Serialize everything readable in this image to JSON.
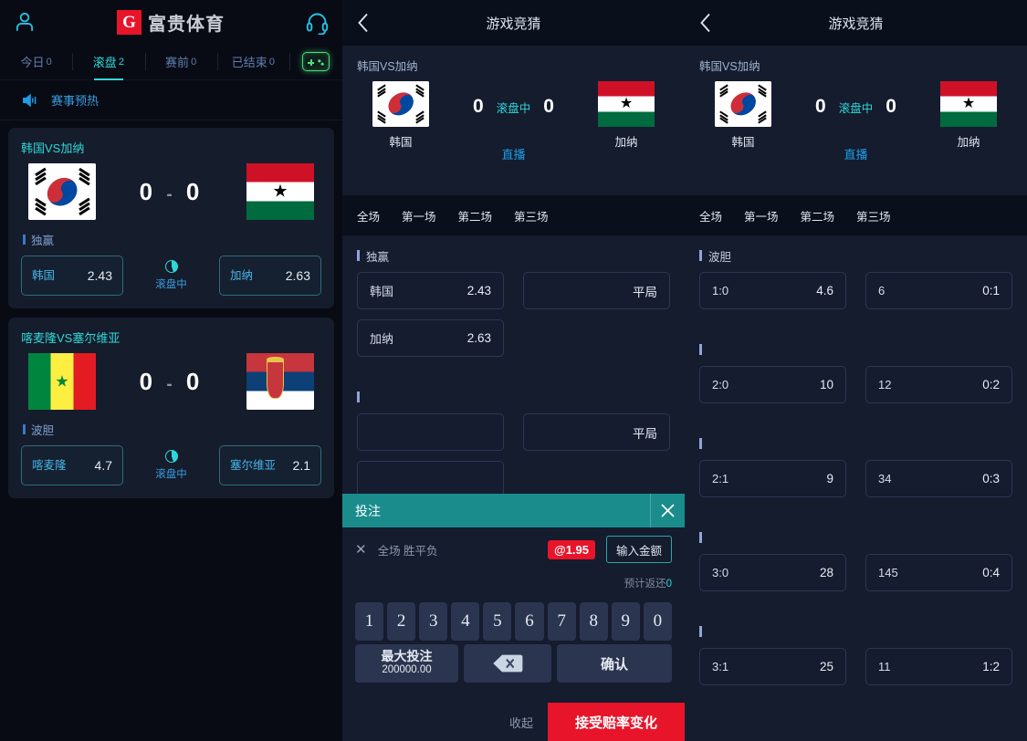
{
  "left": {
    "topbar": {
      "user_icon": "user-icon",
      "brand_mark": "G",
      "brand_text": "富贵体育",
      "support_icon": "headset-icon"
    },
    "tabs": [
      {
        "label": "今日",
        "count": "0",
        "active": false
      },
      {
        "label": "滚盘",
        "count": "2",
        "active": true
      },
      {
        "label": "赛前",
        "count": "0",
        "active": false
      },
      {
        "label": "已结束",
        "count": "0",
        "active": false
      }
    ],
    "gamepad_icon": "gamepad-icon",
    "notice": {
      "icon": "speaker-icon",
      "text": "赛事预热"
    },
    "matches": [
      {
        "title": "韩国VS加纳",
        "home_flag": "kr",
        "away_flag": "gh",
        "score_home": "0",
        "score_sep": "-",
        "score_away": "0",
        "market": "独赢",
        "home": {
          "name": "韩国",
          "odds": "2.43"
        },
        "away": {
          "name": "加纳",
          "odds": "2.63"
        },
        "live_label": "滚盘中"
      },
      {
        "title": "喀麦隆VS塞尔维亚",
        "home_flag": "sn",
        "away_flag": "rs",
        "score_home": "0",
        "score_sep": "-",
        "score_away": "0",
        "market": "波胆",
        "home": {
          "name": "喀麦隆",
          "odds": "4.7"
        },
        "away": {
          "name": "塞尔维亚",
          "odds": "2.1"
        },
        "live_label": "滚盘中"
      }
    ]
  },
  "center": {
    "header": {
      "back_icon": "chevron-left-icon",
      "title": "游戏竞猜"
    },
    "match": {
      "title": "韩国VS加纳",
      "home_name": "韩国",
      "away_name": "加纳",
      "home_flag": "kr",
      "away_flag": "gh",
      "score_home": "0",
      "score_away": "0",
      "status": "滚盘中",
      "live_link": "直播"
    },
    "tabs": [
      "全场",
      "第一场",
      "第二场",
      "第三场"
    ],
    "markets": [
      {
        "name": "独赢",
        "cells": [
          {
            "label": "韩国",
            "value": "2.43"
          },
          {
            "label": "",
            "value": "平局"
          },
          {
            "label": "加纳",
            "value": "2.63"
          },
          {
            "label": "",
            "value": ""
          }
        ]
      },
      {
        "name": "",
        "cells": [
          {
            "label": "",
            "value": ""
          },
          {
            "label": "",
            "value": "平局"
          },
          {
            "label": "",
            "value": ""
          },
          {
            "label": "",
            "value": ""
          }
        ]
      }
    ]
  },
  "right": {
    "header": {
      "back_icon": "chevron-left-icon",
      "title": "游戏竞猜"
    },
    "match": {
      "title": "韩国VS加纳",
      "home_name": "韩国",
      "away_name": "加纳",
      "home_flag": "kr",
      "away_flag": "gh",
      "score_home": "0",
      "score_away": "0",
      "status": "滚盘中",
      "live_link": "直播"
    },
    "tabs": [
      "全场",
      "第一场",
      "第二场",
      "第三场"
    ],
    "markets": [
      {
        "name": "波胆",
        "cells": [
          {
            "label": "1:0",
            "value": "4.6"
          },
          {
            "label": "6",
            "value": "0:1"
          }
        ]
      },
      {
        "name": "",
        "cells": [
          {
            "label": "2:0",
            "value": "10"
          },
          {
            "label": "12",
            "value": "0:2"
          }
        ]
      },
      {
        "name": "",
        "cells": [
          {
            "label": "2:1",
            "value": "9"
          },
          {
            "label": "34",
            "value": "0:3"
          }
        ]
      },
      {
        "name": "",
        "cells": [
          {
            "label": "3:0",
            "value": "28"
          },
          {
            "label": "145",
            "value": "0:4"
          }
        ]
      },
      {
        "name": "",
        "cells": [
          {
            "label": "3:1",
            "value": "25"
          },
          {
            "label": "11",
            "value": "1:2"
          }
        ]
      }
    ]
  },
  "betslip": {
    "title": "投注",
    "close_icon": "close-icon",
    "remove_icon": "remove-x-icon",
    "selection": "全场 胜平负",
    "odds": "@1.95",
    "amount_placeholder": "输入金额",
    "amount_value": "",
    "return_label": "预计返还",
    "return_value": "0",
    "keys": [
      "1",
      "2",
      "3",
      "4",
      "5",
      "6",
      "7",
      "8",
      "9",
      "0"
    ],
    "max_bet_label": "最大投注",
    "max_bet_value": "200000.00",
    "backspace_icon": "backspace-icon",
    "confirm_label": "确认",
    "collapse_label": "收起",
    "accept_label": "接受赔率变化"
  },
  "colors": {
    "accent_teal": "#2fd8d8",
    "brand_red": "#e8142a",
    "panel_bg": "#141c2e",
    "sidebar_bg": "#080b14",
    "header_bg": "#0a0f1c",
    "card_bg": "#151c2c",
    "link_blue": "#1f9de8",
    "gamepad_green": "#49e07a"
  }
}
